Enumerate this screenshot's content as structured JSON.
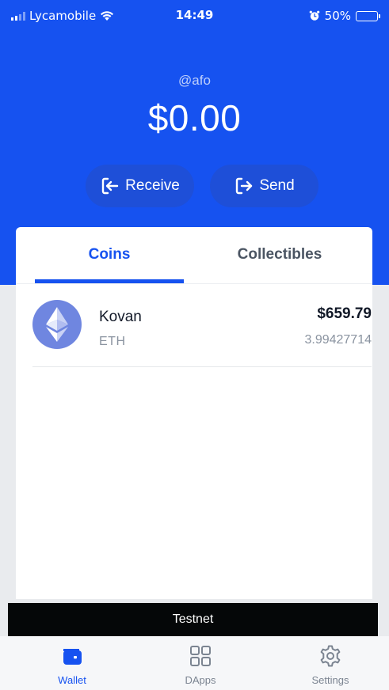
{
  "status_bar": {
    "carrier": "Lycamobile",
    "time": "14:49",
    "battery": "50%",
    "icons": [
      "signal-icon",
      "wifi-icon",
      "alarm-icon",
      "battery-icon"
    ]
  },
  "header": {
    "username": "@afo",
    "balance": "$0.00",
    "receive_label": "Receive",
    "send_label": "Send",
    "background_color": "#1652f0"
  },
  "tabs": [
    {
      "label": "Coins",
      "active": true
    },
    {
      "label": "Collectibles",
      "active": false
    }
  ],
  "coins": [
    {
      "name": "Kovan",
      "symbol": "ETH",
      "value": "$659.79",
      "amount": "3.99427714",
      "icon": "ethereum-icon"
    }
  ],
  "banner": {
    "label": "Testnet"
  },
  "bottom_nav": [
    {
      "label": "Wallet",
      "icon": "wallet-icon",
      "active": true
    },
    {
      "label": "DApps",
      "icon": "grid-icon",
      "active": false
    },
    {
      "label": "Settings",
      "icon": "gear-icon",
      "active": false
    }
  ]
}
